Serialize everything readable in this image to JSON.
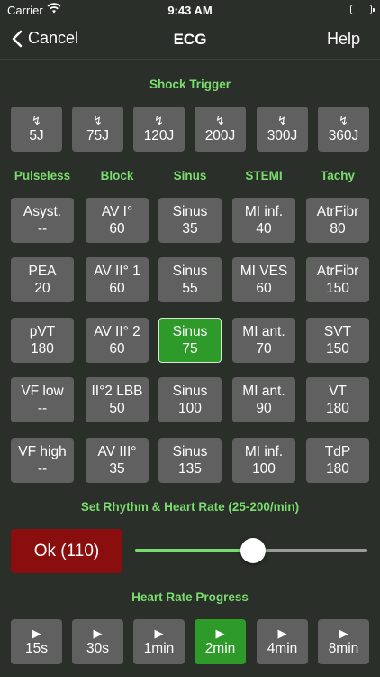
{
  "status_bar": {
    "carrier": "Carrier",
    "time": "9:43 AM"
  },
  "nav": {
    "cancel": "Cancel",
    "title": "ECG",
    "help": "Help"
  },
  "shock": {
    "title": "Shock Trigger",
    "icon": "↯",
    "buttons": [
      "5J",
      "75J",
      "120J",
      "200J",
      "300J",
      "360J"
    ]
  },
  "rhythm": {
    "columns": [
      "Pulseless",
      "Block",
      "Sinus",
      "STEMI",
      "Tachy"
    ],
    "grid": [
      [
        {
          "name": "Asyst.",
          "rate": "--"
        },
        {
          "name": "AV I°",
          "rate": "60"
        },
        {
          "name": "Sinus",
          "rate": "35"
        },
        {
          "name": "MI inf.",
          "rate": "40"
        },
        {
          "name": "AtrFibr",
          "rate": "80"
        }
      ],
      [
        {
          "name": "PEA",
          "rate": "20"
        },
        {
          "name": "AV II° 1",
          "rate": "60"
        },
        {
          "name": "Sinus",
          "rate": "55"
        },
        {
          "name": "MI VES",
          "rate": "60"
        },
        {
          "name": "AtrFibr",
          "rate": "150"
        }
      ],
      [
        {
          "name": "pVT",
          "rate": "180"
        },
        {
          "name": "AV II° 2",
          "rate": "60"
        },
        {
          "name": "Sinus",
          "rate": "75"
        },
        {
          "name": "MI ant.",
          "rate": "70"
        },
        {
          "name": "SVT",
          "rate": "150"
        }
      ],
      [
        {
          "name": "VF low",
          "rate": "--"
        },
        {
          "name": "II°2 LBB",
          "rate": "50"
        },
        {
          "name": "Sinus",
          "rate": "100"
        },
        {
          "name": "MI ant.",
          "rate": "90"
        },
        {
          "name": "VT",
          "rate": "180"
        }
      ],
      [
        {
          "name": "VF high",
          "rate": "--"
        },
        {
          "name": "AV III°",
          "rate": "35"
        },
        {
          "name": "Sinus",
          "rate": "135"
        },
        {
          "name": "MI inf.",
          "rate": "100"
        },
        {
          "name": "TdP",
          "rate": "180"
        }
      ]
    ],
    "selected": "Sinus 75"
  },
  "heart_rate": {
    "title": "Set Rhythm & Heart Rate (25-200/min)",
    "ok_label": "Ok (110)",
    "slider_level": 0.5
  },
  "progress": {
    "title": "Heart Rate Progress",
    "icon": "▶",
    "buttons": [
      "15s",
      "30s",
      "1min",
      "2min",
      "4min",
      "8min"
    ],
    "selected": "2min"
  },
  "colors": {
    "accent": "#7bdc6e",
    "active": "#2e9a2a",
    "danger": "#8a0e0e",
    "button": "#5f605f",
    "background": "#2a2f2a"
  }
}
